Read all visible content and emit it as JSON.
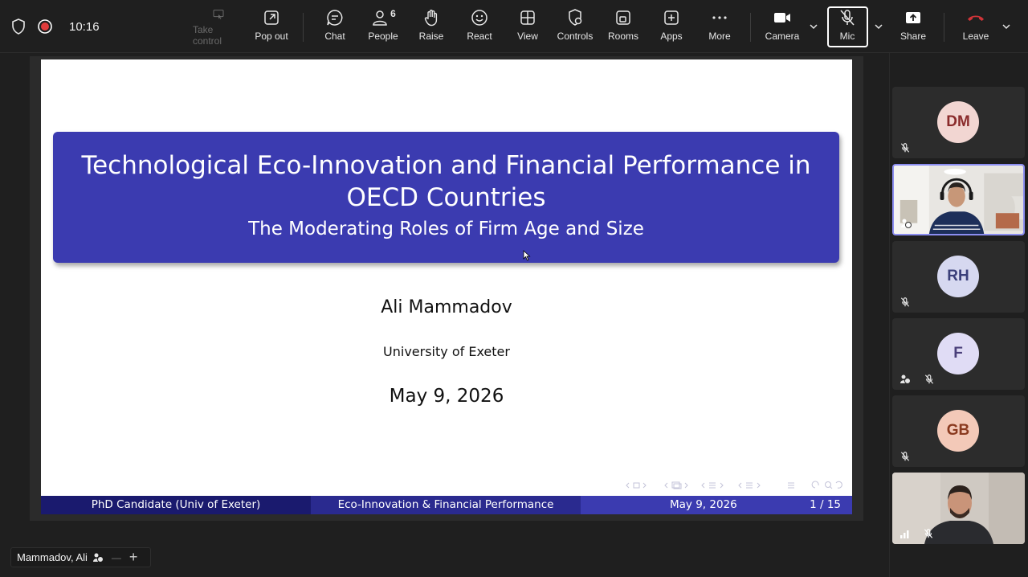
{
  "topbar": {
    "time": "10:16",
    "buttons": {
      "take_control": "Take control",
      "pop_out": "Pop out",
      "chat": "Chat",
      "people": "People",
      "people_count": "6",
      "raise": "Raise",
      "react": "React",
      "view": "View",
      "controls": "Controls",
      "rooms": "Rooms",
      "apps": "Apps",
      "more": "More",
      "camera": "Camera",
      "mic": "Mic",
      "share": "Share",
      "leave": "Leave"
    },
    "leave_color": "#d13438"
  },
  "slide": {
    "title": "Technological Eco-Innovation and Financial Performance in OECD Countries",
    "subtitle": "The Moderating Roles of Firm Age and Size",
    "author": "Ali Mammadov",
    "institute": "University of Exeter",
    "date": "May 9, 2026",
    "footer": {
      "left": "PhD Candidate  (Univ of Exeter)",
      "center": "Eco-Innovation & Financial Performance",
      "date": "May 9, 2026",
      "page": "1 / 15"
    },
    "theme_color": "#3b3bb0"
  },
  "name_tag": {
    "name": "Mammadov, Ali",
    "minus": "—",
    "plus": "+"
  },
  "participants": [
    {
      "initials": "DM",
      "avatar_bg": "#f2d6d2",
      "avatar_fg": "#8a2b2b",
      "muted": true
    },
    {
      "initials": "",
      "video": true,
      "active": true
    },
    {
      "initials": "RH",
      "avatar_bg": "#d6d8f0",
      "avatar_fg": "#3a3f7a",
      "muted": true
    },
    {
      "initials": "F",
      "avatar_bg": "#e0dcf5",
      "avatar_fg": "#4a3f7a",
      "muted": true
    },
    {
      "initials": "GB",
      "avatar_bg": "#f3c9b8",
      "avatar_fg": "#8a3a1f",
      "muted": true
    },
    {
      "initials": "",
      "video": true,
      "muted": true
    }
  ]
}
